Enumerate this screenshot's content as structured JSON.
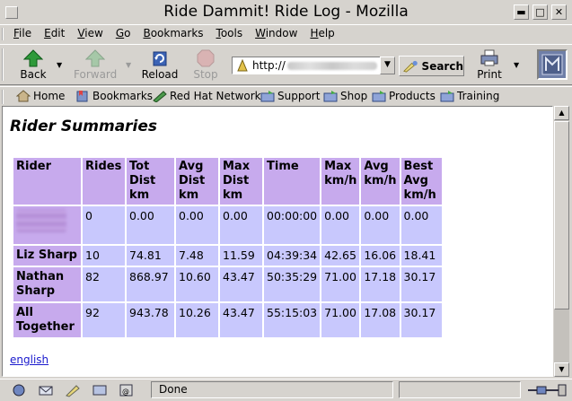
{
  "window": {
    "title": "Ride Dammit! Ride Log - Mozilla"
  },
  "menu": [
    "File",
    "Edit",
    "View",
    "Go",
    "Bookmarks",
    "Tools",
    "Window",
    "Help"
  ],
  "toolbar": {
    "back": "Back",
    "forward": "Forward",
    "reload": "Reload",
    "stop": "Stop",
    "url_prefix": "http://",
    "search": "Search",
    "print": "Print"
  },
  "personal_bar": [
    "Home",
    "Bookmarks",
    "Red Hat Network",
    "Support",
    "Shop",
    "Products",
    "Training"
  ],
  "page": {
    "heading": "Rider Summaries",
    "table": {
      "headers": [
        "Rider",
        "Rides",
        "Tot Dist km",
        "Avg Dist km",
        "Max Dist km",
        "Time",
        "Max km/h",
        "Avg km/h",
        "Best Avg km/h"
      ],
      "rows": [
        {
          "rider": "",
          "rider_blurred": true,
          "cells": [
            "0",
            "0.00",
            "0.00",
            "0.00",
            "00:00:00",
            "0.00",
            "0.00",
            "0.00"
          ]
        },
        {
          "rider": "Liz Sharp",
          "rider_blurred": false,
          "cells": [
            "10",
            "74.81",
            "7.48",
            "11.59",
            "04:39:34",
            "42.65",
            "16.06",
            "18.41"
          ]
        },
        {
          "rider": "Nathan Sharp",
          "rider_blurred": false,
          "cells": [
            "82",
            "868.97",
            "10.60",
            "43.47",
            "50:35:29",
            "71.00",
            "17.18",
            "30.17"
          ]
        },
        {
          "rider": "All Together",
          "rider_blurred": false,
          "cells": [
            "92",
            "943.78",
            "10.26",
            "43.47",
            "55:15:03",
            "71.00",
            "17.08",
            "30.17"
          ]
        }
      ]
    },
    "language_link": "english"
  },
  "status": {
    "text": "Done"
  },
  "colors": {
    "header_bg": "#c7aaed",
    "cell_bg": "#c8c8fd",
    "link": "#1a1acd"
  }
}
